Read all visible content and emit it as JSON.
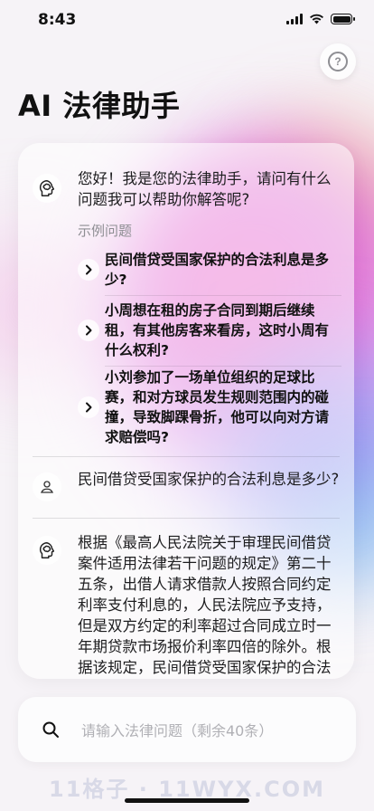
{
  "status_bar": {
    "time": "8:43"
  },
  "header": {
    "title": "AI 法律助手"
  },
  "chat": {
    "greeting": "您好！我是您的法律助手，请问有什么问题我可以帮助你解答呢?",
    "examples_label": "示例问题",
    "examples": [
      "民间借贷受国家保护的合法利息是多少?",
      "小周想在租的房子合同到期后继续租，有其他房客来看房，这时小周有什么权利?",
      "小刘参加了一场单位组织的足球比赛，和对方球员发生规则范围内的碰撞，导致脚踝骨折，他可以向对方请求赔偿吗?"
    ],
    "user_message": "民间借贷受国家保护的合法利息是多少?",
    "assistant_reply": "根据《最高人民法院关于审理民间借贷案件适用法律若干问题的规定》第二十五条，出借人请求借款人按照合同约定利率支付利息的，人民法院应予支持，但是双方约定的利率超过合同成立时一年期贷款市场报价利率四倍的除外。根据该规定，民间借贷受国家保护的合法利息不得超过合同成立时一年期贷款市场报价利率的四倍。"
  },
  "input": {
    "placeholder": "请输入法律问题（剩余40条）",
    "value": ""
  },
  "watermark": "11格子 · 11WYX.COM",
  "colors": {
    "accent_pink": "#f06bc7",
    "accent_purple": "#8b7df0",
    "text": "#1d1d1f",
    "muted": "#8e8e93"
  }
}
